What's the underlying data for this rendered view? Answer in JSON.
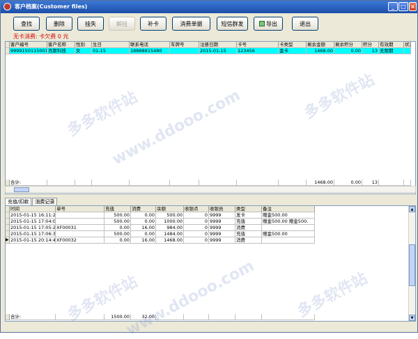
{
  "window": {
    "title": "客户档案(Customer files)"
  },
  "toolbar": [
    {
      "name": "search-button",
      "label": "查找",
      "disabled": false
    },
    {
      "name": "delete-button",
      "label": "删除",
      "disabled": false
    },
    {
      "name": "report-loss-button",
      "label": "挂失",
      "disabled": false
    },
    {
      "name": "unfreeze-button",
      "label": "解挂",
      "disabled": true
    },
    {
      "name": "reissue-card-button",
      "label": "补卡",
      "disabled": false
    },
    {
      "name": "consumption-list-button",
      "label": "消费单据",
      "disabled": false
    },
    {
      "name": "sms-group-button",
      "label": "短信群发",
      "disabled": false
    },
    {
      "name": "export-button",
      "label": "导出",
      "disabled": false,
      "icon": "excel-icon"
    },
    {
      "name": "exit-button",
      "label": "退出",
      "disabled": false
    }
  ],
  "status_text": "无卡消费: 卡欠费 0 元",
  "customer_grid": {
    "headers": [
      "客户编号",
      "客户名称",
      "性别",
      "生日",
      "联系电话",
      "车牌号",
      "注册日期",
      "卡号",
      "卡类型",
      "剩余金额",
      "剩余积分",
      "积分",
      "有效期",
      "状态"
    ],
    "rows": [
      [
        "9999150115001",
        "肖斯科技",
        "女",
        "01-15",
        "18888815480",
        "",
        "2015-01-15",
        "123456",
        "金卡",
        "1468.00",
        "0.00",
        "13",
        "无限期",
        ""
      ]
    ],
    "totals": {
      "label": "合计:",
      "balance": "1468.00",
      "points_balance": "0.00",
      "points": "13"
    }
  },
  "tabs": [
    "充值/扣款",
    "消费记录"
  ],
  "recharge_grid": {
    "headers": [
      "时间",
      "单号",
      "充值",
      "消费",
      "余额",
      "收银点",
      "收银员",
      "类型",
      "备注"
    ],
    "rows": [
      [
        "2015-01-15 16:11:25",
        "",
        "500.00",
        "0.00",
        "500.00",
        "0",
        "9999",
        "发卡",
        "赠金500.00"
      ],
      [
        "2015-01-15 17:04:07",
        "",
        "500.00",
        "0.00",
        "1000.00",
        "0",
        "9999",
        "充值",
        "赠金500.00 赠金500."
      ],
      [
        "2015-01-15 17:05:24",
        "XF00031",
        "0.00",
        "16.00",
        "984.00",
        "0",
        "9999",
        "消费",
        ""
      ],
      [
        "2015-01-15 17:06:31",
        "",
        "500.00",
        "0.00",
        "1484.00",
        "0",
        "9999",
        "充值",
        "赠金500.00"
      ],
      [
        "2015-01-15 20:14:48",
        "XF00032",
        "0.00",
        "16.00",
        "1468.00",
        "0",
        "9999",
        "消费",
        ""
      ]
    ],
    "totals": {
      "label": "合计:",
      "recharge": "1500.00",
      "consume": "32.00"
    }
  },
  "watermarks": [
    "多多软件站",
    "www.ddooo.com"
  ]
}
